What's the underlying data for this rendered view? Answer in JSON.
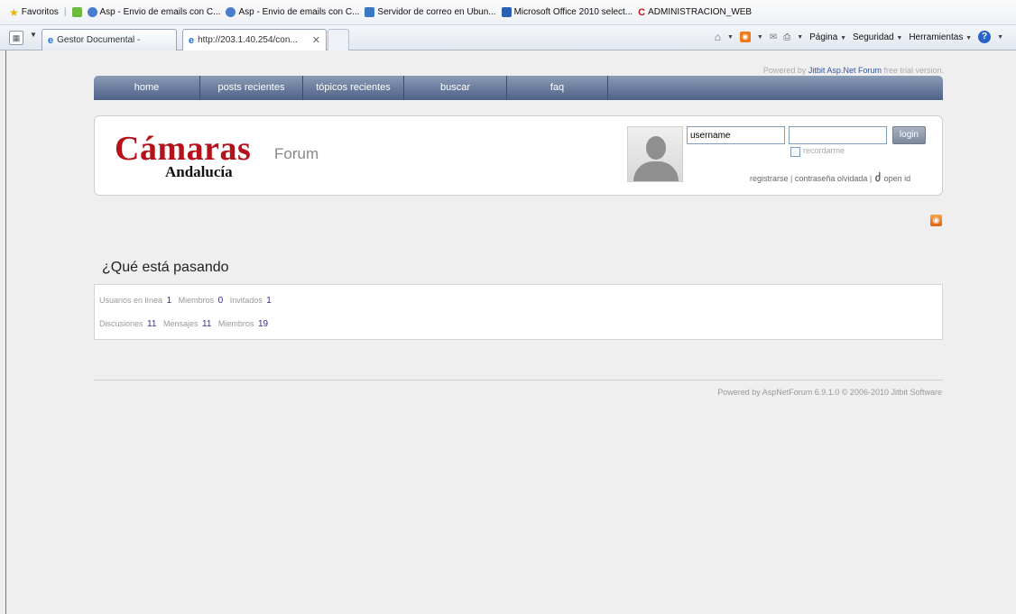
{
  "browser": {
    "favorites_label": "Favoritos",
    "favorites": [
      "Asp - Envio de emails con C...",
      "Asp - Envio de emails con C...",
      "Servidor de correo en Ubun...",
      "Microsoft Office 2010 select...",
      "ADMINISTRACION_WEB"
    ],
    "tabs": [
      {
        "label": "Gestor Documental -",
        "active": false
      },
      {
        "label": "http://203.1.40.254/con...",
        "active": true
      }
    ],
    "commands": {
      "page": "Página",
      "security": "Seguridad",
      "tools": "Herramientas"
    }
  },
  "page": {
    "powered_top": {
      "prefix": "Powered by",
      "link": "Jitbit Asp.Net Forum",
      "suffix": "free trial version."
    },
    "nav": [
      "home",
      "posts recientes",
      "tópicos recientes",
      "buscar",
      "faq"
    ],
    "logo": {
      "main": "Cámaras",
      "sub": "Andalucía"
    },
    "forum_label": "Forum",
    "login": {
      "username_value": "username",
      "password_value": "",
      "button": "login",
      "remember": "recordarme",
      "register": "registrarse",
      "forgot": "contraseña olvidada",
      "openid": "open id"
    },
    "section_title": "¿Qué está pasando",
    "stats": {
      "online_label": "Usuarios en línea",
      "online": "1",
      "members_label": "Miembros",
      "members": "0",
      "guests_label": "Invitados",
      "guests": "1",
      "discussions_label": "Discusiones",
      "discussions": "11",
      "messages_label": "Mensajes",
      "messages": "11",
      "total_members_label": "Miembros",
      "total_members": "19"
    },
    "footer": "Powered by AspNetForum 6.9.1.0 © 2006-2010 Jitbit Software"
  },
  "colors": {
    "brand_red": "#b5121b",
    "nav_blue": "#4e6288",
    "stat_number": "#3a2a8a"
  }
}
